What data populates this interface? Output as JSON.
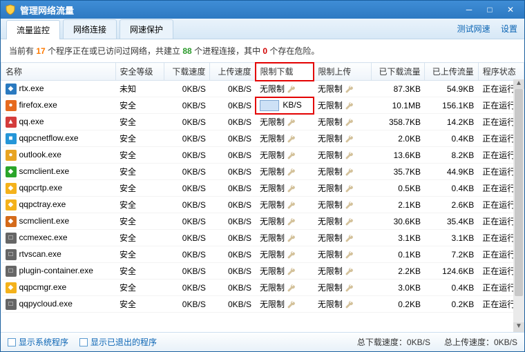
{
  "window": {
    "title": "管理网络流量"
  },
  "tabs": {
    "monitor": "流量监控",
    "conn": "网络连接",
    "protect": "网速保护"
  },
  "toplinks": {
    "speedtest": "测试网速",
    "settings": "设置"
  },
  "summary": {
    "p1": "当前有 ",
    "n1": "17",
    "p2": " 个程序正在或已访问过网络，共建立 ",
    "n2": "88",
    "p3": " 个进程连接，其中 ",
    "n3": "0",
    "p4": " 个存在危险。"
  },
  "headers": {
    "name": "名称",
    "safety": "安全等级",
    "dn": "下载速度",
    "up": "上传速度",
    "limdn": "限制下载",
    "limup": "限制上传",
    "dnsum": "已下载流量",
    "upsum": "已上传流量",
    "state": "程序状态"
  },
  "rows": [
    {
      "name": "rtx.exe",
      "safety": "未知",
      "dn": "0KB/S",
      "up": "0KB/S",
      "limdn": "无限制",
      "limup": "无限制",
      "dnsum": "87.3KB",
      "upsum": "54.9KB",
      "state": "正在运行",
      "color": "#2a7ac0",
      "sym": "◆"
    },
    {
      "name": "firefox.exe",
      "safety": "安全",
      "dn": "0KB/S",
      "up": "0KB/S",
      "limdn_edit": true,
      "limdn_unit": "KB/S",
      "limup": "无限制",
      "dnsum": "10.1MB",
      "upsum": "156.1KB",
      "state": "正在运行",
      "color": "#e66a1f",
      "sym": "●"
    },
    {
      "name": "qq.exe",
      "safety": "安全",
      "dn": "0KB/S",
      "up": "0KB/S",
      "limdn": "无限制",
      "limup": "无限制",
      "dnsum": "358.7KB",
      "upsum": "14.2KB",
      "state": "正在运行",
      "color": "#d43c3c",
      "sym": "▲"
    },
    {
      "name": "qqpcnetflow.exe",
      "safety": "安全",
      "dn": "0KB/S",
      "up": "0KB/S",
      "limdn": "无限制",
      "limup": "无限制",
      "dnsum": "2.0KB",
      "upsum": "0.4KB",
      "state": "正在运行",
      "color": "#2596d8",
      "sym": "■"
    },
    {
      "name": "outlook.exe",
      "safety": "安全",
      "dn": "0KB/S",
      "up": "0KB/S",
      "limdn": "无限制",
      "limup": "无限制",
      "dnsum": "13.6KB",
      "upsum": "8.2KB",
      "state": "正在运行",
      "color": "#e8a422",
      "sym": "●"
    },
    {
      "name": "scmclient.exe",
      "safety": "安全",
      "dn": "0KB/S",
      "up": "0KB/S",
      "limdn": "无限制",
      "limup": "无限制",
      "dnsum": "35.7KB",
      "upsum": "44.9KB",
      "state": "正在运行",
      "color": "#2aa52a",
      "sym": "◆"
    },
    {
      "name": "qqpcrtp.exe",
      "safety": "安全",
      "dn": "0KB/S",
      "up": "0KB/S",
      "limdn": "无限制",
      "limup": "无限制",
      "dnsum": "0.5KB",
      "upsum": "0.4KB",
      "state": "正在运行",
      "color": "#f4b21b",
      "sym": "◆"
    },
    {
      "name": "qqpctray.exe",
      "safety": "安全",
      "dn": "0KB/S",
      "up": "0KB/S",
      "limdn": "无限制",
      "limup": "无限制",
      "dnsum": "2.1KB",
      "upsum": "2.6KB",
      "state": "正在运行",
      "color": "#f4b21b",
      "sym": "◆"
    },
    {
      "name": "scmclient.exe",
      "safety": "安全",
      "dn": "0KB/S",
      "up": "0KB/S",
      "limdn": "无限制",
      "limup": "无限制",
      "dnsum": "30.6KB",
      "upsum": "35.4KB",
      "state": "正在运行",
      "color": "#d46a1a",
      "sym": "◆"
    },
    {
      "name": "ccmexec.exe",
      "safety": "安全",
      "dn": "0KB/S",
      "up": "0KB/S",
      "limdn": "无限制",
      "limup": "无限制",
      "dnsum": "3.1KB",
      "upsum": "3.1KB",
      "state": "正在运行",
      "color": "#666666",
      "sym": "□"
    },
    {
      "name": "rtvscan.exe",
      "safety": "安全",
      "dn": "0KB/S",
      "up": "0KB/S",
      "limdn": "无限制",
      "limup": "无限制",
      "dnsum": "0.1KB",
      "upsum": "7.2KB",
      "state": "正在运行",
      "color": "#666666",
      "sym": "□"
    },
    {
      "name": "plugin-container.exe",
      "safety": "安全",
      "dn": "0KB/S",
      "up": "0KB/S",
      "limdn": "无限制",
      "limup": "无限制",
      "dnsum": "2.2KB",
      "upsum": "124.6KB",
      "state": "正在运行",
      "color": "#666666",
      "sym": "□"
    },
    {
      "name": "qqpcmgr.exe",
      "safety": "安全",
      "dn": "0KB/S",
      "up": "0KB/S",
      "limdn": "无限制",
      "limup": "无限制",
      "dnsum": "3.0KB",
      "upsum": "0.4KB",
      "state": "正在运行",
      "color": "#f4b21b",
      "sym": "◆"
    },
    {
      "name": "qqpycloud.exe",
      "safety": "安全",
      "dn": "0KB/S",
      "up": "0KB/S",
      "limdn": "无限制",
      "limup": "无限制",
      "dnsum": "0.2KB",
      "upsum": "0.2KB",
      "state": "正在运行",
      "color": "#666666",
      "sym": "□"
    }
  ],
  "footer": {
    "showsys": "显示系统程序",
    "showexit": "显示已退出的程序",
    "dnrate_l": "总下载速度：",
    "dnrate_v": "0KB/S",
    "uprate_l": "总上传速度：",
    "uprate_v": "0KB/S"
  }
}
